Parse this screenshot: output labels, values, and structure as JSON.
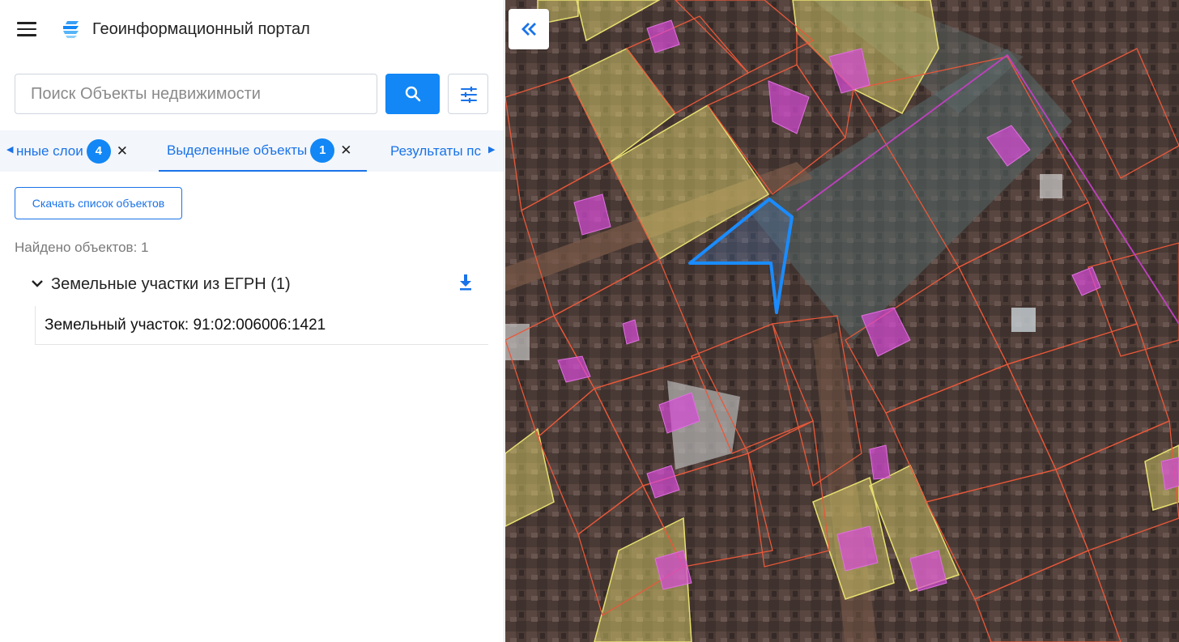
{
  "header": {
    "title": "Геоинформационный портал"
  },
  "search": {
    "placeholder": "Поиск Объекты недвижимости"
  },
  "tabs": [
    {
      "label": "нные слои",
      "badge": "4",
      "closable": true,
      "active": false
    },
    {
      "label": "Выделенные объекты",
      "badge": "1",
      "closable": true,
      "active": true
    },
    {
      "label": "Результаты пс",
      "badge": "",
      "closable": false,
      "active": false
    }
  ],
  "icons": {
    "close_glyph": "✕"
  },
  "main": {
    "download_list_label": "Скачать список объектов",
    "found_text": "Найдено объектов: 1",
    "groups": [
      {
        "title": "Земельные участки из ЕГРН (1)",
        "items": [
          {
            "label": "Земельный участок: 91:02:006006:1421"
          }
        ]
      }
    ]
  },
  "colors": {
    "accent": "#1287f5",
    "link": "#1a73e8",
    "parcel_outline": "#e8583a",
    "selected_outline": "#1a8cff",
    "building_fill": "#d84bd8",
    "highlight_fill": "#e8e070"
  }
}
